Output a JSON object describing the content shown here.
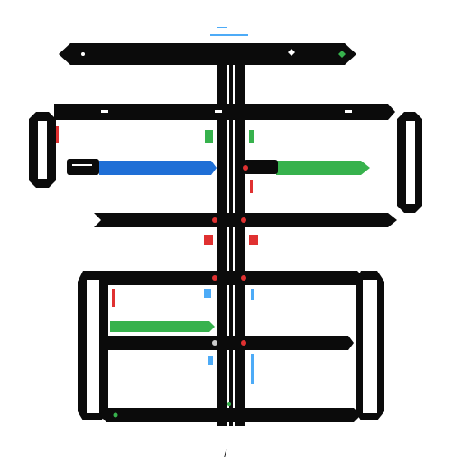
{
  "colors": {
    "black": "#0b0b0b",
    "blue": "#1f6fd6",
    "green": "#37b24d",
    "red": "#e03131",
    "cyan": "#4dabf7",
    "gray": "#777777"
  },
  "texts": {
    "header_caption": "",
    "footer_glyph": "/"
  }
}
